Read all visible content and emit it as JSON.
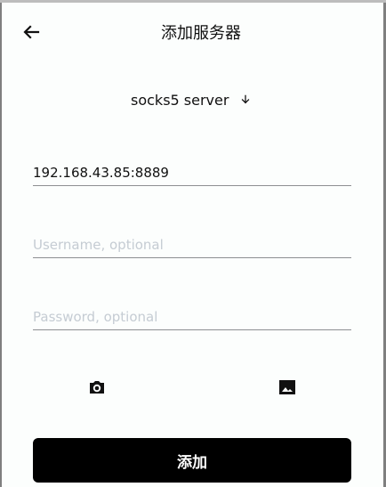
{
  "header": {
    "title": "添加服务器",
    "back_icon": "arrow-left-icon"
  },
  "server_type": {
    "label": "socks5 server",
    "icon": "arrow-down-icon"
  },
  "form": {
    "address_value": "192.168.43.85:8889",
    "username_placeholder": "Username, optional",
    "password_placeholder": "Password, optional"
  },
  "actions": {
    "camera_icon": "camera-icon",
    "image_icon": "image-icon",
    "submit_label": "添加"
  }
}
